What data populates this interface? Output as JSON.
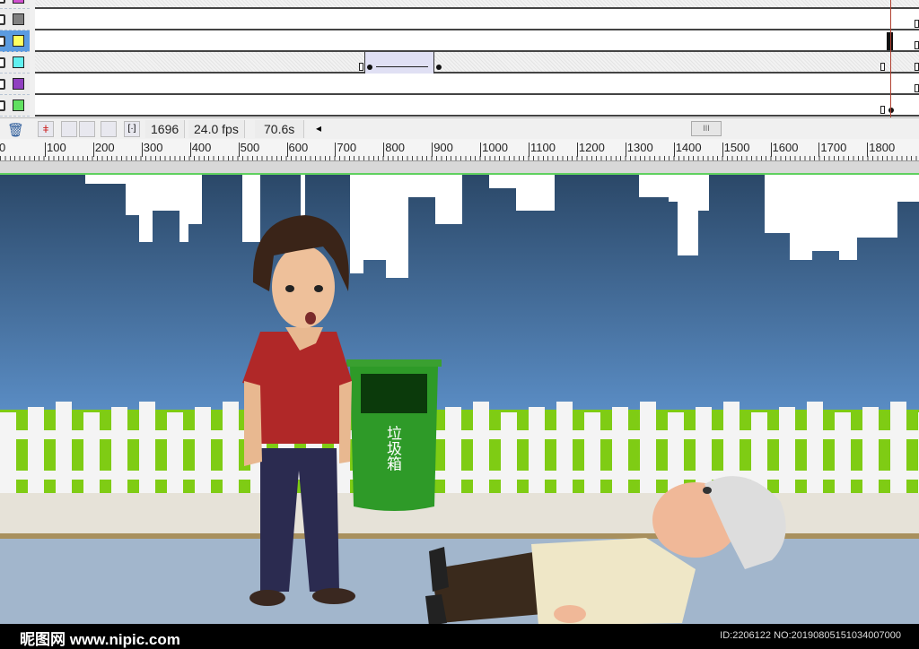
{
  "timeline": {
    "layers": [
      {
        "color": "#d050d0",
        "selected": false
      },
      {
        "color": "#808080",
        "selected": false
      },
      {
        "color": "#ffff60",
        "selected": true
      },
      {
        "color": "#60f0f0",
        "selected": false
      },
      {
        "color": "#9040c0",
        "selected": false
      },
      {
        "color": "#60e060",
        "selected": false
      }
    ],
    "current_frame": "1696",
    "fps": "24.0 fps",
    "elapsed": "70.6s",
    "scroll_left_icon": "◂",
    "scroll_thumb": "III"
  },
  "ruler": {
    "labels": [
      "0",
      "100",
      "200",
      "300",
      "400",
      "500",
      "600",
      "700",
      "800",
      "900",
      "1000",
      "1100",
      "1200",
      "1300",
      "1400",
      "1500",
      "1600",
      "1700",
      "1800"
    ]
  },
  "scene": {
    "trash_bin_label": "垃圾箱"
  },
  "footer": {
    "watermark": "昵图网 www.nipic.com",
    "image_id": "ID:2206122 NO:20190805151034007000"
  }
}
